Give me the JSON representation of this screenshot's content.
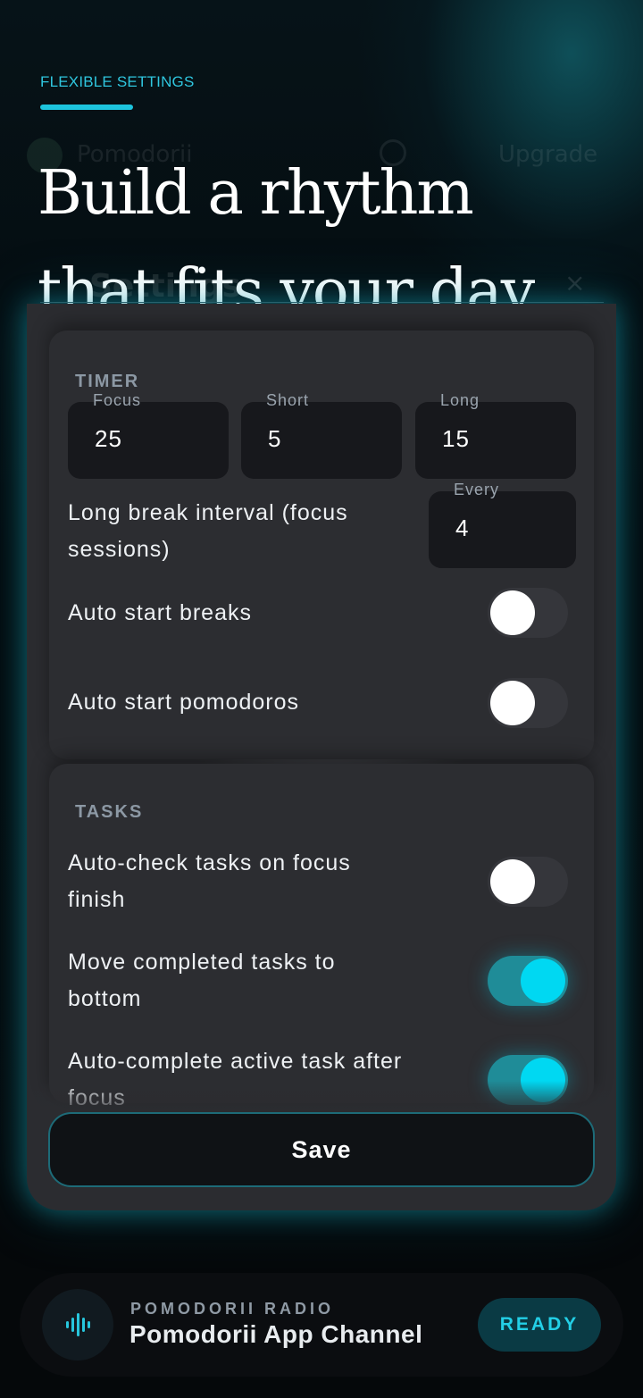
{
  "hero": {
    "eyebrow": "FLEXIBLE SETTINGS",
    "headline_line1": "Build a rhythm",
    "headline_line2": "that fits your day."
  },
  "background_app": {
    "name": "Pomodorii",
    "upgrade_label": "Upgrade",
    "modal_title": "Settings",
    "close_glyph": "×"
  },
  "settings": {
    "timer": {
      "title": "TIMER",
      "durations": [
        {
          "label": "Focus",
          "value": "25"
        },
        {
          "label": "Short",
          "value": "5"
        },
        {
          "label": "Long",
          "value": "15"
        }
      ],
      "interval_label": "Long break interval (focus sessions)",
      "interval_field": {
        "label": "Every",
        "value": "4"
      },
      "auto_start_breaks": {
        "label": "Auto start breaks",
        "on": false
      },
      "auto_start_pomodoros": {
        "label": "Auto start pomodoros",
        "on": false
      }
    },
    "tasks": {
      "title": "TASKS",
      "auto_check": {
        "label": "Auto-check tasks on focus finish",
        "on": false
      },
      "move_completed": {
        "label": "Move completed tasks to bottom",
        "on": true
      },
      "auto_complete": {
        "label": "Auto-complete active task after focus",
        "on": true
      }
    },
    "save_label": "Save"
  },
  "radio": {
    "kicker": "POMODORII RADIO",
    "channel": "Pomodorii App Channel",
    "status": "READY",
    "icon": "audio-wave-icon"
  },
  "colors": {
    "accent": "#1dc4dd",
    "toggle_on_knob": "#00d8f2",
    "toggle_on_track": "#1f8c98",
    "card": "#2b2c30",
    "field": "#17181c"
  }
}
